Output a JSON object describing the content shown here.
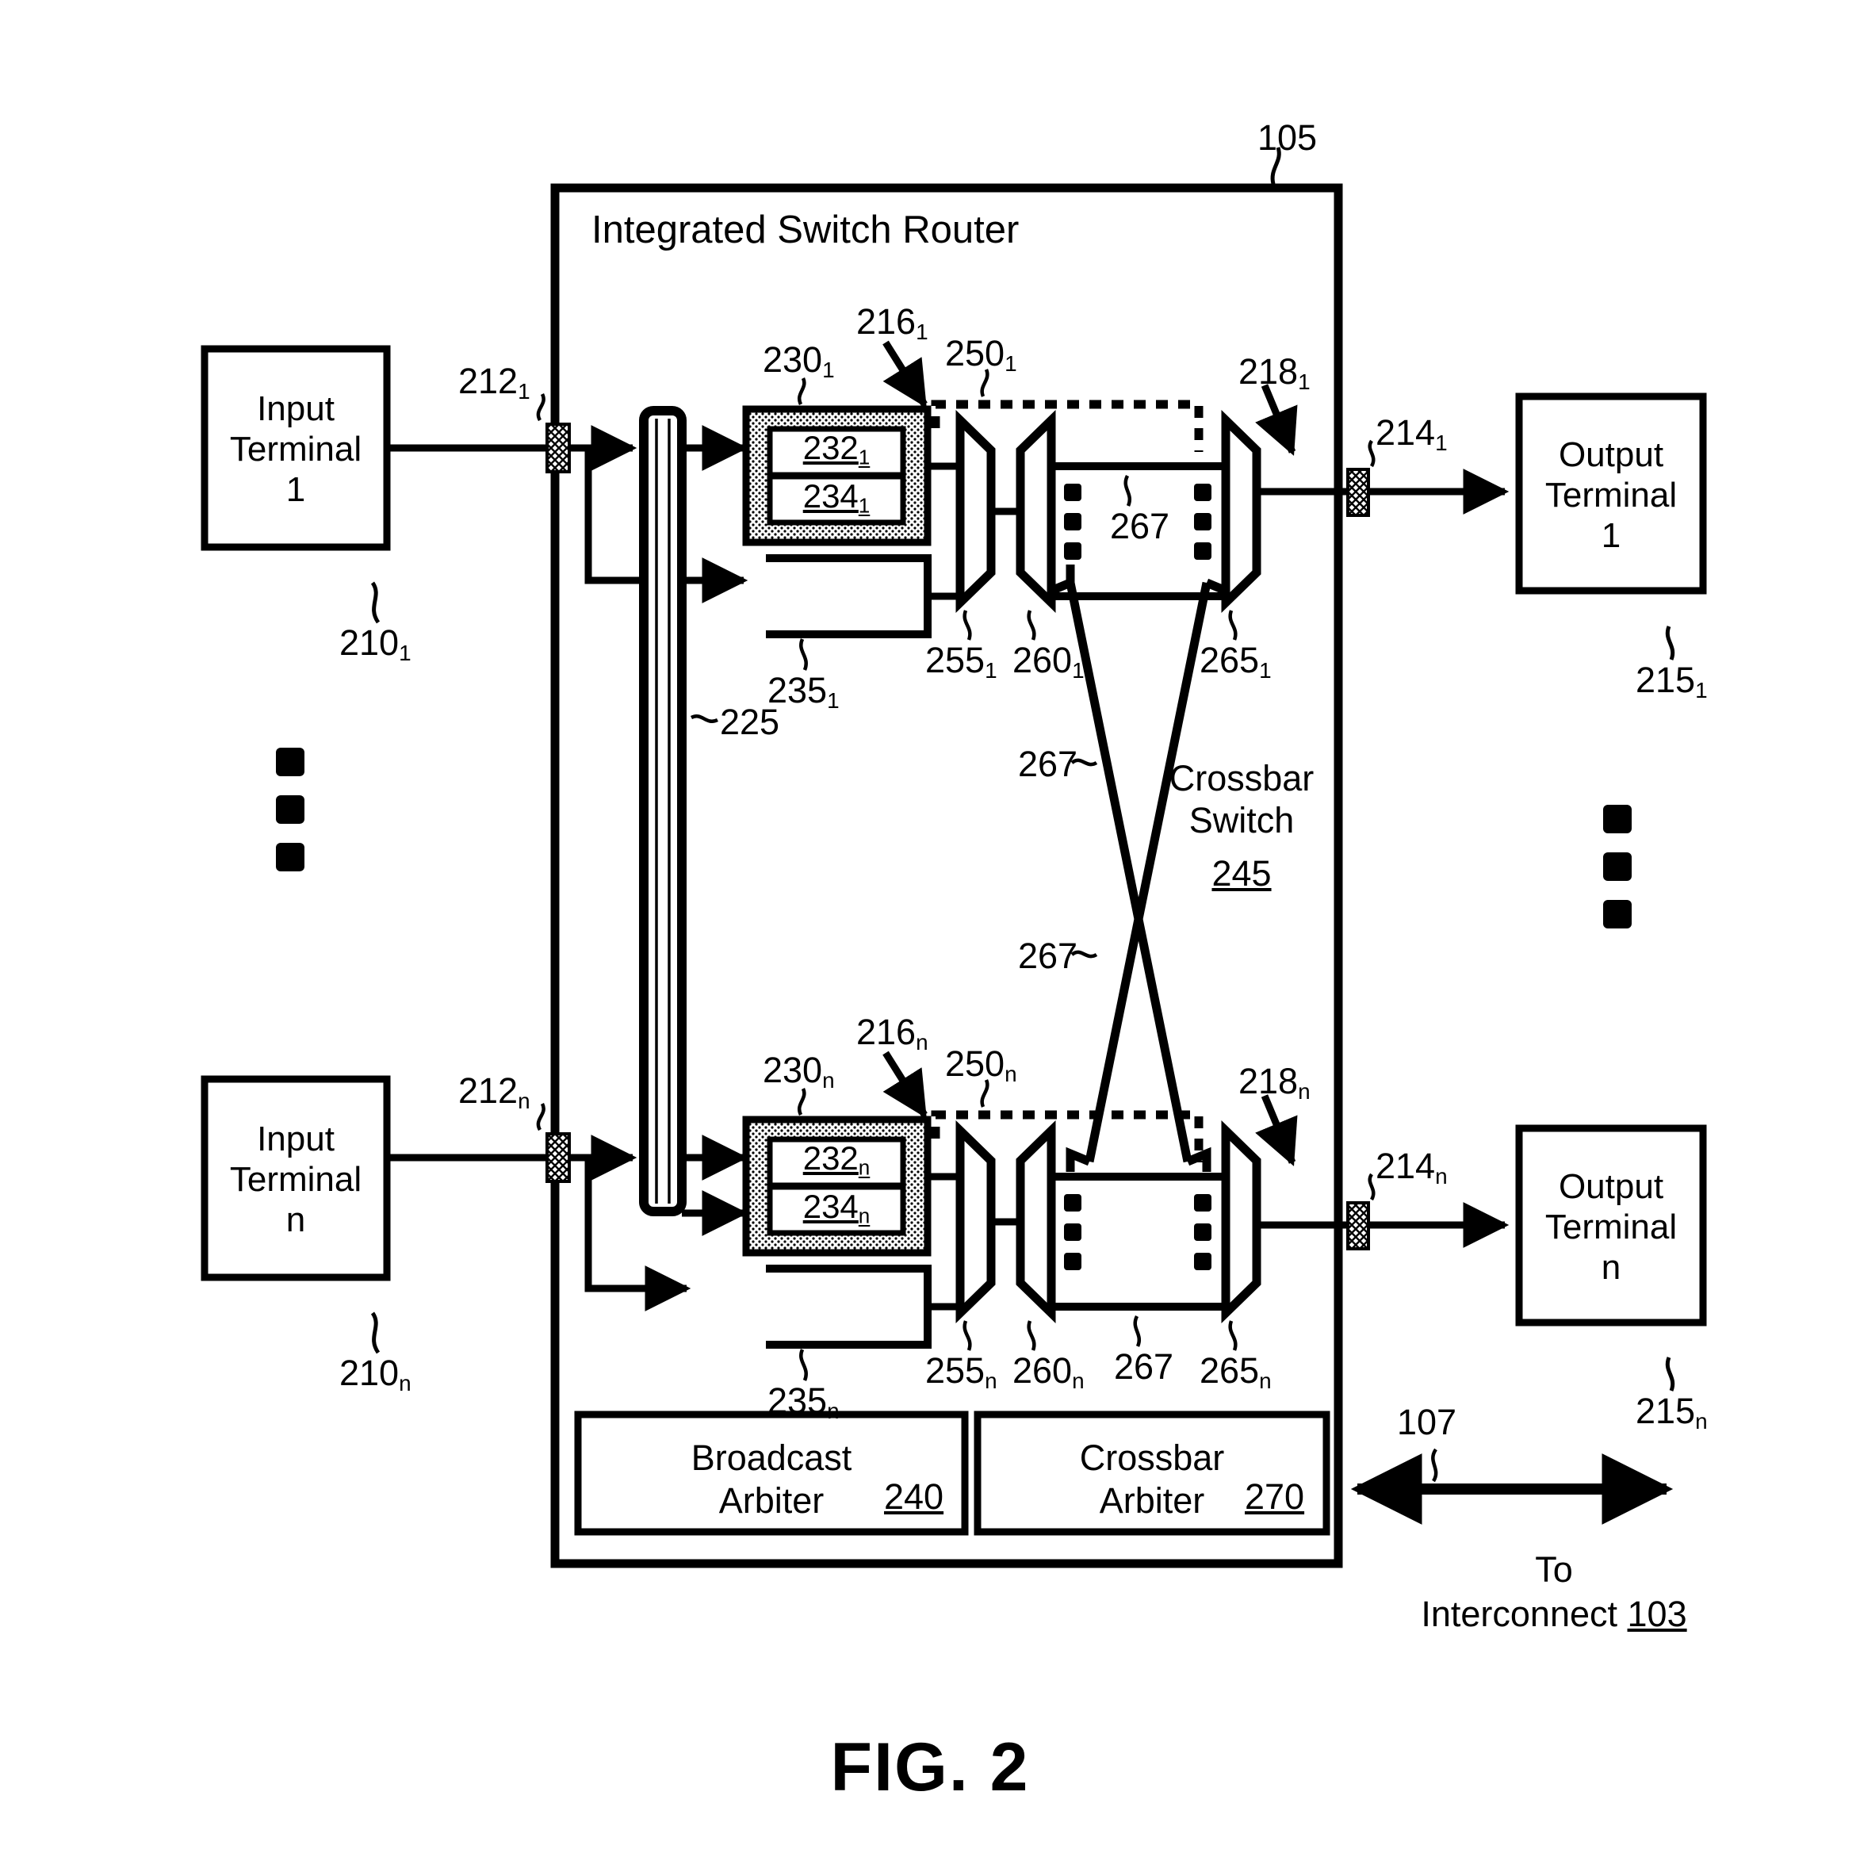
{
  "figure": {
    "caption": "FIG. 2",
    "main_block_title": "Integrated Switch Router",
    "main_block_ref": "105"
  },
  "inputs": [
    {
      "label_line1": "Input",
      "label_line2": "Terminal",
      "label_line3": "1",
      "ref": "210",
      "ref_sub": "1",
      "link_ref": "212",
      "link_sub": "1"
    },
    {
      "label_line1": "Input",
      "label_line2": "Terminal",
      "label_line3": "n",
      "ref": "210",
      "ref_sub": "n",
      "link_ref": "212",
      "link_sub": "n"
    }
  ],
  "outputs": [
    {
      "label_line1": "Output",
      "label_line2": "Terminal",
      "label_line3": "1",
      "ref": "215",
      "ref_sub": "1",
      "link_ref": "214",
      "link_sub": "1"
    },
    {
      "label_line1": "Output",
      "label_line2": "Terminal",
      "label_line3": "n",
      "ref": "215",
      "ref_sub": "n",
      "link_ref": "214",
      "link_sub": "n"
    }
  ],
  "bus": {
    "ref": "225"
  },
  "rows": [
    {
      "buffer_ref": "230",
      "buffer_sub": "1",
      "queue_hi_ref": "232",
      "queue_hi_sub": "1",
      "queue_lo_ref": "234",
      "queue_lo_sub": "1",
      "bypass_ref": "235",
      "bypass_sub": "1",
      "arrow_ref": "216",
      "arrow_sub": "1",
      "dotted_ref": "250",
      "dotted_sub": "1",
      "mux1_ref": "255",
      "mux1_sub": "1",
      "mux2_ref": "260",
      "mux2_sub": "1",
      "mux3_ref": "265",
      "mux3_sub": "1",
      "out_arrow_ref": "218",
      "out_arrow_sub": "1",
      "xbar_line_ref": "267"
    },
    {
      "buffer_ref": "230",
      "buffer_sub": "n",
      "queue_hi_ref": "232",
      "queue_hi_sub": "n",
      "queue_lo_ref": "234",
      "queue_lo_sub": "n",
      "bypass_ref": "235",
      "bypass_sub": "n",
      "arrow_ref": "216",
      "arrow_sub": "n",
      "dotted_ref": "250",
      "dotted_sub": "n",
      "mux1_ref": "255",
      "mux1_sub": "n",
      "mux2_ref": "260",
      "mux2_sub": "n",
      "mux3_ref": "265",
      "mux3_sub": "n",
      "out_arrow_ref": "218",
      "out_arrow_sub": "n",
      "xbar_line_ref": "267"
    }
  ],
  "crossbar": {
    "title_line1": "Crossbar",
    "title_line2": "Switch",
    "ref": "245",
    "line_ref_upper": "267",
    "line_ref_lower": "267"
  },
  "arbiters": [
    {
      "line1": "Broadcast",
      "line2": "Arbiter",
      "ref": "240"
    },
    {
      "line1": "Crossbar",
      "line2": "Arbiter",
      "ref": "270"
    }
  ],
  "interconnect": {
    "arrow_ref": "107",
    "text_line1": "To",
    "text_line2": "Interconnect",
    "text_ref": "103"
  }
}
